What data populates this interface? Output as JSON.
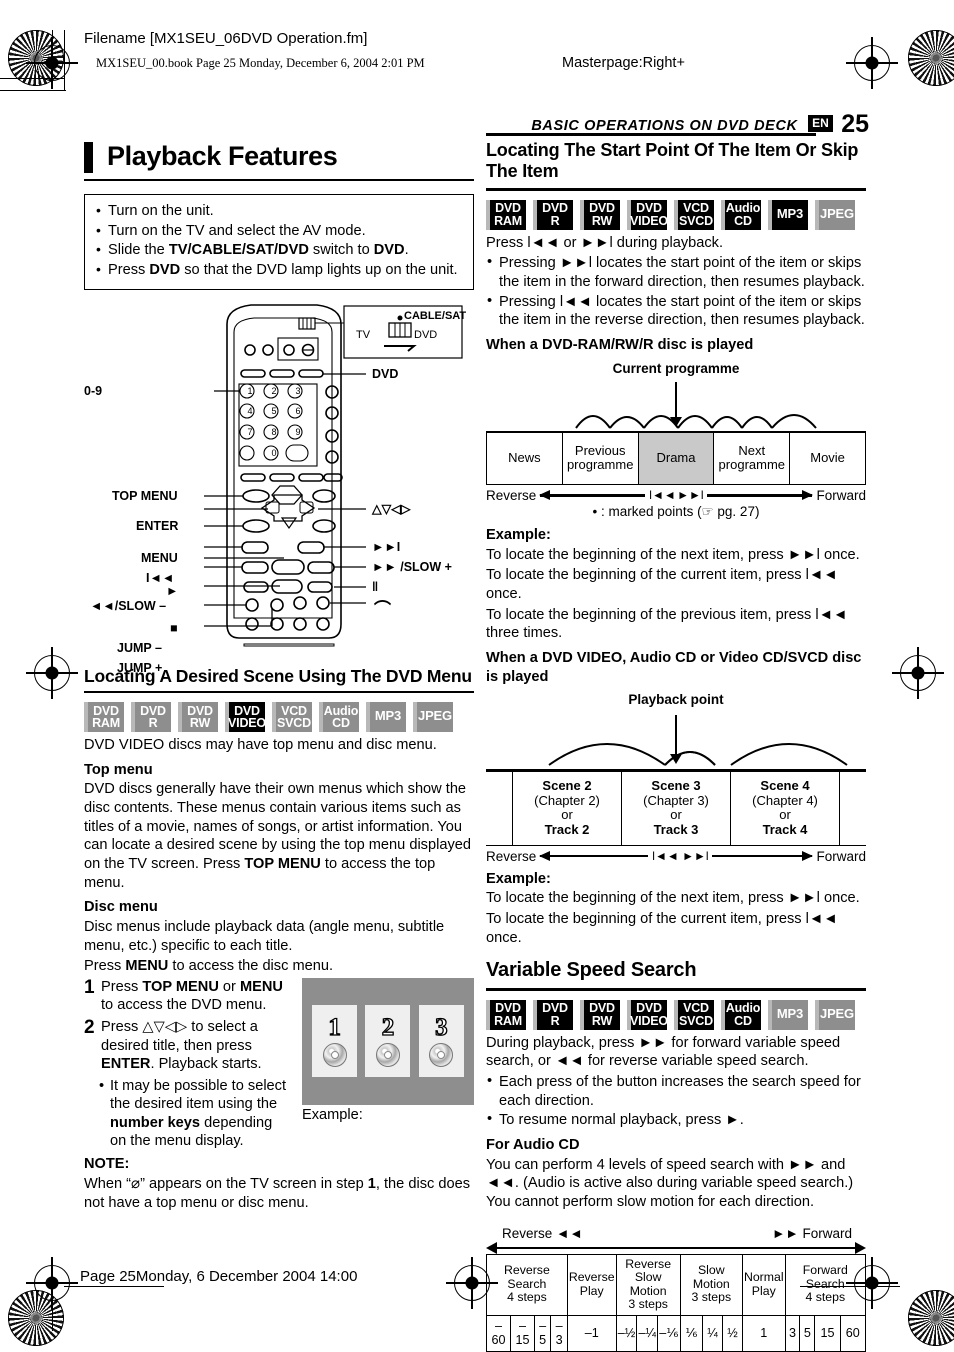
{
  "header": {
    "filename": "Filename [MX1SEU_06DVD Operation.fm]",
    "bookline": "MX1SEU_00.book  Page 25  Monday, December 6, 2004  2:01 PM",
    "masterpage": "Masterpage:Right+",
    "running_head": "BASIC OPERATIONS ON DVD DECK",
    "lang_tag": "EN",
    "page_number": "25"
  },
  "footer": {
    "text": "Page 25Monday, 6 December 2004  14:00"
  },
  "left_column": {
    "title": "Playback Features",
    "prep_steps": [
      "Turn on the unit.",
      "Turn on the TV and select the AV mode.",
      "Slide the TV/CABLE/SAT/DVD switch to DVD.",
      "Press DVD so that the DVD lamp lights up on the unit."
    ],
    "remote": {
      "switch_box": {
        "top": "CABLE/SAT",
        "left": "TV",
        "right": "DVD"
      },
      "labels_left": [
        "0-9",
        "TOP MENU",
        "ENTER",
        "MENU",
        "Ɩ◄◄",
        "►",
        "◄◄/SLOW –",
        "■",
        "JUMP –",
        "JUMP +"
      ],
      "labels_right": [
        "DVD",
        "△▽◁▷",
        "►►Ɩ",
        "►► /SLOW +",
        "‖",
        "⌒"
      ]
    },
    "section2": {
      "title": "Locating A Desired Scene Using The DVD Menu",
      "badges": [
        {
          "l1": "DVD",
          "l2": "RAM",
          "state": "off"
        },
        {
          "l1": "DVD",
          "l2": "R",
          "state": "off"
        },
        {
          "l1": "DVD",
          "l2": "RW",
          "state": "off"
        },
        {
          "l1": "DVD",
          "l2": "VIDEO",
          "state": "on"
        },
        {
          "l1": "VCD",
          "l2": "SVCD",
          "state": "off"
        },
        {
          "l1": "Audio",
          "l2": "CD",
          "state": "off"
        },
        {
          "l1": "MP3",
          "l2": "",
          "state": "off"
        },
        {
          "l1": "JPEG",
          "l2": "",
          "state": "off"
        }
      ],
      "intro": "DVD VIDEO discs may have top menu and disc menu.",
      "topmenu_head": "Top menu",
      "topmenu_body": "DVD discs generally have their own menus which show the disc contents. These menus contain various items such as titles of a movie, names of songs, or artist information. You can locate a desired scene by using the top menu displayed on the TV screen. Press TOP MENU to access the top menu.",
      "discmenu_head": "Disc menu",
      "discmenu_body1": "Disc menus include playback data (angle menu, subtitle menu, etc.) specific to each title.",
      "discmenu_body2": "Press MENU to access the disc menu.",
      "step1_num": "1",
      "step1_text": "Press TOP MENU or MENU to access the DVD menu.",
      "step2_num": "2",
      "step2_text": "Press △▽◁▷ to select a desired title, then press ENTER. Playback starts.",
      "step2_sub": "It may be possible to select the desired item using the number keys depending on the menu display.",
      "tv_example": {
        "caption": "Example:",
        "tiles": [
          "1",
          "2",
          "3"
        ]
      },
      "note_head": "NOTE:",
      "note_body": "When “⃠” appears on the TV screen in step 1, the disc does not have a top menu or disc menu."
    }
  },
  "right_column": {
    "section1": {
      "title": "Locating The Start Point Of The Item Or Skip The Item",
      "badges": [
        {
          "l1": "DVD",
          "l2": "RAM",
          "state": "on"
        },
        {
          "l1": "DVD",
          "l2": "R",
          "state": "on"
        },
        {
          "l1": "DVD",
          "l2": "RW",
          "state": "on"
        },
        {
          "l1": "DVD",
          "l2": "VIDEO",
          "state": "on"
        },
        {
          "l1": "VCD",
          "l2": "SVCD",
          "state": "on"
        },
        {
          "l1": "Audio",
          "l2": "CD",
          "state": "on"
        },
        {
          "l1": "MP3",
          "l2": "",
          "state": "on"
        },
        {
          "l1": "JPEG",
          "l2": "",
          "state": "off"
        }
      ],
      "intro": "Press Ɩ◄◄ or ►►Ɩ during playback.",
      "bullets": [
        "Pressing ►►Ɩ locates the start point of the item or skips the item in the forward direction, then resumes playback.",
        "Pressing Ɩ◄◄ locates the start point of the item or skips the item in the reverse direction, then resumes playback."
      ],
      "case1_head": "When a DVD-RAM/RW/R disc is played",
      "diagram1": {
        "caption": "Current programme",
        "cells": [
          "News",
          "Previous programme",
          "Drama",
          "Next programme",
          "Movie"
        ],
        "highlight_index": 2,
        "reverse_label": "Reverse",
        "forward_label": "Forward",
        "skip_back": "Ɩ◄◄",
        "skip_fwd": "►►Ɩ",
        "marked_note": "• : marked points (☞ pg. 27)"
      },
      "example1_head": "Example:",
      "example1_lines": [
        "To locate the beginning of the next item, press ►►Ɩ once.",
        "To locate the beginning of the current item, press Ɩ◄◄ once.",
        "To locate the beginning of the previous item, press Ɩ◄◄ three times."
      ],
      "case2_head": "When a DVD VIDEO, Audio CD or Video CD/SVCD disc is played",
      "diagram2": {
        "caption": "Playback point",
        "cells": [
          {
            "l1": "Scene 2",
            "l2": "(Chapter 2)",
            "l3": "or",
            "l4": "Track 2"
          },
          {
            "l1": "Scene 3",
            "l2": "(Chapter 3)",
            "l3": "or",
            "l4": "Track 3"
          },
          {
            "l1": "Scene 4",
            "l2": "(Chapter 4)",
            "l3": "or",
            "l4": "Track 4"
          }
        ],
        "reverse_label": "Reverse",
        "forward_label": "Forward",
        "skip_back": "Ɩ◄◄",
        "skip_fwd": "►►Ɩ"
      },
      "example2_head": "Example:",
      "example2_lines": [
        "To locate the beginning of the next item, press ►►Ɩ once.",
        "To locate the beginning of the current item, press Ɩ◄◄ once."
      ]
    },
    "section2": {
      "title": "Variable Speed Search",
      "badges": [
        {
          "l1": "DVD",
          "l2": "RAM",
          "state": "on"
        },
        {
          "l1": "DVD",
          "l2": "R",
          "state": "on"
        },
        {
          "l1": "DVD",
          "l2": "RW",
          "state": "on"
        },
        {
          "l1": "DVD",
          "l2": "VIDEO",
          "state": "on"
        },
        {
          "l1": "VCD",
          "l2": "SVCD",
          "state": "on"
        },
        {
          "l1": "Audio",
          "l2": "CD",
          "state": "on"
        },
        {
          "l1": "MP3",
          "l2": "",
          "state": "off"
        },
        {
          "l1": "JPEG",
          "l2": "",
          "state": "off"
        }
      ],
      "intro": "During playback, press ►► for forward variable speed search, or ◄◄ for reverse variable speed search.",
      "bullets": [
        "Each press of the button increases the search speed for each direction.",
        "To resume normal playback, press ►."
      ],
      "audiocd_head": "For Audio CD",
      "audiocd_body": "You can perform 4 levels of speed search with ►► and ◄◄. (Audio is active also during variable speed search.) You cannot perform slow motion for each direction.",
      "speed_table": {
        "reverse_label": "Reverse ◄◄",
        "forward_label": "►► Forward",
        "groups": [
          {
            "label": "Reverse Search\n4 steps",
            "values": [
              "–60",
              "–15",
              "–5",
              "–3"
            ]
          },
          {
            "label": "Reverse\nPlay",
            "values": [
              "–1"
            ]
          },
          {
            "label": "Reverse\nSlow Motion\n3 steps",
            "values": [
              "–½",
              "–¼",
              "–⅙"
            ]
          },
          {
            "label": "Slow Motion\n3 steps",
            "values": [
              "⅙",
              "¼",
              "½"
            ]
          },
          {
            "label": "Normal\nPlay",
            "values": [
              "1"
            ]
          },
          {
            "label": "Forward Search\n4 steps",
            "values": [
              "3",
              "5",
              "15",
              "60"
            ]
          }
        ]
      }
    }
  }
}
